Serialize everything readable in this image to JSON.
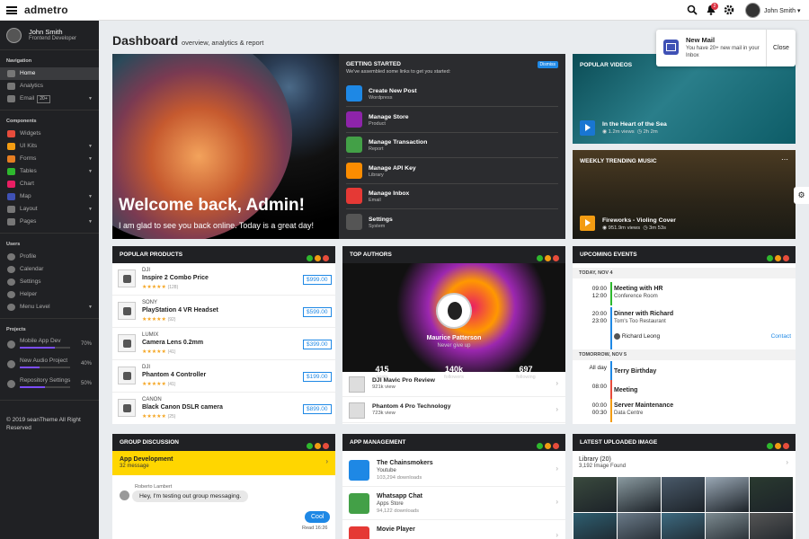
{
  "app": {
    "logo": "admetro",
    "user": "John Smith",
    "notif_count": "2"
  },
  "sidebar": {
    "user_name": "John Smith",
    "user_role": "Frontend Developer",
    "nav_heading": "Navigation",
    "nav": [
      {
        "label": "Home",
        "badge": "",
        "caret": false
      },
      {
        "label": "Analytics",
        "badge": "",
        "caret": false
      },
      {
        "label": "Email",
        "badge": "20+",
        "caret": true
      }
    ],
    "components_heading": "Components",
    "components": [
      {
        "label": "Widgets",
        "color": "#e74c3c",
        "caret": false
      },
      {
        "label": "UI Kits",
        "color": "#f39c12",
        "caret": true
      },
      {
        "label": "Forms",
        "color": "#e67e22",
        "caret": true
      },
      {
        "label": "Tables",
        "color": "#2eb82e",
        "caret": true
      },
      {
        "label": "Chart",
        "color": "#e91e63",
        "caret": false
      },
      {
        "label": "Map",
        "color": "#3f51b5",
        "caret": true
      },
      {
        "label": "Layout",
        "color": "#777",
        "caret": true
      },
      {
        "label": "Pages",
        "color": "#777",
        "caret": true
      }
    ],
    "users_heading": "Users",
    "users": [
      {
        "label": "Profile",
        "caret": false
      },
      {
        "label": "Calendar",
        "caret": false
      },
      {
        "label": "Settings",
        "caret": false
      },
      {
        "label": "Helper",
        "caret": false
      },
      {
        "label": "Menu Level",
        "caret": true
      }
    ],
    "projects_heading": "Projects",
    "projects": [
      {
        "label": "Mobile App Dev",
        "pct": "70%",
        "progress": 0.7
      },
      {
        "label": "New Audio Project",
        "pct": "40%",
        "progress": 0.4
      },
      {
        "label": "Repository Settings",
        "pct": "50%",
        "progress": 0.5
      }
    ],
    "copyright": "© 2019 seanTheme All Right Reserved"
  },
  "page": {
    "title": "Dashboard",
    "subtitle": "overview, analytics & report"
  },
  "hero": {
    "title": "Welcome back, Admin!",
    "subtitle": "I am glad to see you back online. Today is a great day!"
  },
  "getting_started": {
    "title": "GETTING STARTED",
    "desc": "We've assembled some links to get you started:",
    "dismiss": "Dismiss",
    "items": [
      {
        "title": "Create New Post",
        "desc": "Wordpress",
        "color": "#1e88e5"
      },
      {
        "title": "Manage Store",
        "desc": "Product",
        "color": "#8e24aa"
      },
      {
        "title": "Manage Transaction",
        "desc": "Report",
        "color": "#43a047"
      },
      {
        "title": "Manage API Key",
        "desc": "Library",
        "color": "#fb8c00"
      },
      {
        "title": "Manage Inbox",
        "desc": "Email",
        "color": "#e53935"
      },
      {
        "title": "Settings",
        "desc": "System",
        "color": "#555"
      }
    ]
  },
  "popular_videos": {
    "title": "POPULAR VIDEOS",
    "video_title": "In the Heart of the Sea",
    "views": "1.2m views",
    "duration": "2h 2m"
  },
  "trending_music": {
    "title": "WEEKLY TRENDING MUSIC",
    "track": "Fireworks - Violing Cover",
    "views": "951.9m views",
    "duration": "3m 53s"
  },
  "notification": {
    "title": "New Mail",
    "desc": "You have 20+ new mail in your Inbox",
    "close": "Close"
  },
  "popular_products": {
    "title": "POPULAR PRODUCTS",
    "items": [
      {
        "brand": "DJI",
        "name": "Inspire 2 Combo Price",
        "reviews": "(128)",
        "price": "$999.00"
      },
      {
        "brand": "SONY",
        "name": "PlayStation 4 VR Headset",
        "reviews": "(92)",
        "price": "$599.00"
      },
      {
        "brand": "LUMIX",
        "name": "Camera Lens 0.2mm",
        "reviews": "(41)",
        "price": "$399.00"
      },
      {
        "brand": "DJI",
        "name": "Phantom 4 Controller",
        "reviews": "(41)",
        "price": "$199.00"
      },
      {
        "brand": "CANON",
        "name": "Black Canon DSLR camera",
        "reviews": "(25)",
        "price": "$899.00"
      }
    ]
  },
  "top_authors": {
    "title": "TOP AUTHORS",
    "name": "Maurice Patterson",
    "motto": "Never give up",
    "stats": [
      {
        "value": "415",
        "label": "posts"
      },
      {
        "value": "140k",
        "label": "followers"
      },
      {
        "value": "697",
        "label": "following"
      }
    ],
    "items": [
      {
        "title": "DJI Mavic Pro Review",
        "views": "921k view"
      },
      {
        "title": "Phantom 4 Pro Technology",
        "views": "723k view"
      }
    ]
  },
  "upcoming_events": {
    "title": "UPCOMING EVENTS",
    "today": "TODAY, NOV 4",
    "tomorrow": "TOMORROW, NOV 5",
    "contact": "Contact",
    "today_events": [
      {
        "t1": "09:00",
        "t2": "12:00",
        "name": "Meeting with HR",
        "loc": "Conference Room",
        "color": "#2eb82e"
      },
      {
        "t1": "20:00",
        "t2": "23:00",
        "name": "Dinner with Richard",
        "loc": "Tom's Too Restaurant",
        "color": "#1e88e5",
        "person": "Richard Leong"
      }
    ],
    "tomorrow_events": [
      {
        "t1": "All day",
        "t2": "",
        "name": "Terry Birthday",
        "loc": "",
        "color": "#1e88e5"
      },
      {
        "t1": "08:00",
        "t2": "",
        "name": "Meeting",
        "loc": "",
        "color": "#e74c3c"
      },
      {
        "t1": "00:00",
        "t2": "00:30",
        "name": "Server Maintenance",
        "loc": "Data Centre",
        "color": "#f39c12"
      }
    ]
  },
  "group_discussion": {
    "title": "GROUP DISCUSSION",
    "channel": "App Development",
    "count": "32 message",
    "sender": "Roberto Lambert",
    "msg1": "Hey, I'm testing out group messaging.",
    "msg2": "Cool",
    "read": "Read 16:26"
  },
  "app_management": {
    "title": "APP MANAGEMENT",
    "items": [
      {
        "name": "The Chainsmokers",
        "store": "Youtube",
        "downloads": "103,294 downloads",
        "color": "#1e88e5"
      },
      {
        "name": "Whatsapp Chat",
        "store": "Apps Store",
        "downloads": "94,122 downloads",
        "color": "#43a047"
      },
      {
        "name": "Movie Player",
        "store": "",
        "downloads": "",
        "color": "#e53935"
      }
    ]
  },
  "latest_image": {
    "title": "LATEST UPLOADED IMAGE",
    "library": "Library (20)",
    "found": "3,192 Image Found"
  }
}
